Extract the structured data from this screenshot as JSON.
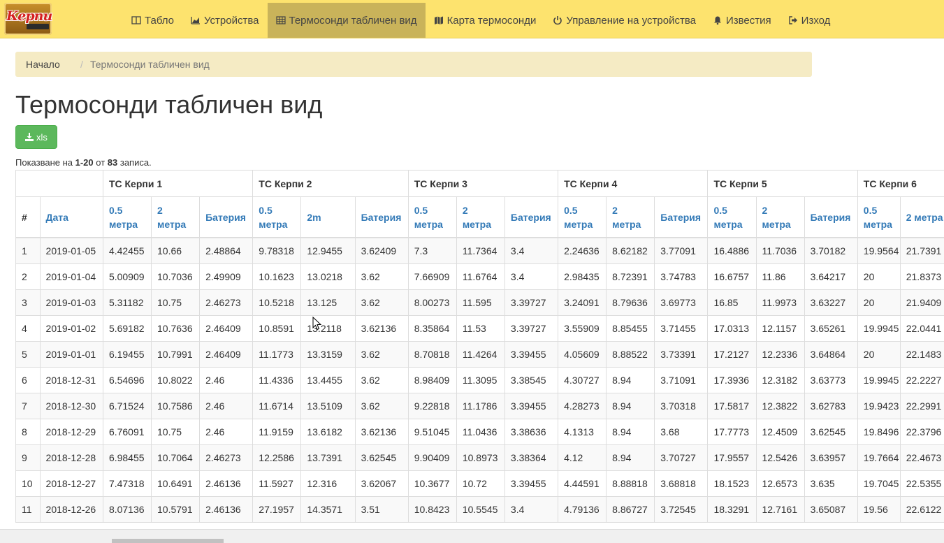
{
  "brand": {
    "text": "Керпи"
  },
  "nav": {
    "items": [
      {
        "label": "Табло",
        "icon": "table-grid-icon"
      },
      {
        "label": "Устройства",
        "icon": "area-chart-icon"
      },
      {
        "label": "Термосонди табличен вид",
        "icon": "table-icon",
        "active": true
      },
      {
        "label": "Карта термосонди",
        "icon": "map-icon"
      },
      {
        "label": "Управление на устройства",
        "icon": "power-icon"
      },
      {
        "label": "Известия",
        "icon": "bell-icon"
      },
      {
        "label": "Изход",
        "icon": "logout-icon"
      }
    ]
  },
  "breadcrumb": {
    "home": "Начало",
    "current": "Термосонди табличен вид"
  },
  "page": {
    "title": "Термосонди табличен вид",
    "xls_label": "xls"
  },
  "summary": {
    "prefix": "Показване на ",
    "range": "1-20",
    "middle": " от ",
    "total": "83",
    "suffix": " записа."
  },
  "table": {
    "groups": [
      "ТС Керпи 1",
      "ТС Керпи 2",
      "ТС Керпи 3",
      "ТС Керпи 4",
      "ТС Керпи 5",
      "ТС Керпи 6"
    ],
    "columns": [
      "#",
      "Дата",
      "0.5 метра",
      "2 метра",
      "Батерия",
      "0.5 метра",
      "2m",
      "Батерия",
      "0.5 метра",
      "2 метра",
      "Батерия",
      "0.5 метра",
      "2 метра",
      "Батерия",
      "0.5 метра",
      "2 метра",
      "Батерия",
      "0.5 метра",
      "2 метра"
    ],
    "rows": [
      [
        "1",
        "2019-01-05",
        "4.42455",
        "10.66",
        "2.48864",
        "9.78318",
        "12.9455",
        "3.62409",
        "7.3",
        "11.7364",
        "3.4",
        "2.24636",
        "8.62182",
        "3.77091",
        "16.4886",
        "11.7036",
        "3.70182",
        "19.9564",
        "21.7391"
      ],
      [
        "2",
        "2019-01-04",
        "5.00909",
        "10.7036",
        "2.49909",
        "10.1623",
        "13.0218",
        "3.62",
        "7.66909",
        "11.6764",
        "3.4",
        "2.98435",
        "8.72391",
        "3.74783",
        "16.6757",
        "11.86",
        "3.64217",
        "20",
        "21.8373"
      ],
      [
        "3",
        "2019-01-03",
        "5.31182",
        "10.75",
        "2.46273",
        "10.5218",
        "13.125",
        "3.62",
        "8.00273",
        "11.595",
        "3.39727",
        "3.24091",
        "8.79636",
        "3.69773",
        "16.85",
        "11.9973",
        "3.63227",
        "20",
        "21.9409"
      ],
      [
        "4",
        "2019-01-02",
        "5.69182",
        "10.7636",
        "2.46409",
        "10.8591",
        "13.2118",
        "3.62136",
        "8.35864",
        "11.53",
        "3.39727",
        "3.55909",
        "8.85455",
        "3.71455",
        "17.0313",
        "12.1157",
        "3.65261",
        "19.9945",
        "22.0441"
      ],
      [
        "5",
        "2019-01-01",
        "6.19455",
        "10.7991",
        "2.46409",
        "11.1773",
        "13.3159",
        "3.62",
        "8.70818",
        "11.4264",
        "3.39455",
        "4.05609",
        "8.88522",
        "3.73391",
        "17.2127",
        "12.2336",
        "3.64864",
        "20",
        "22.1483"
      ],
      [
        "6",
        "2018-12-31",
        "6.54696",
        "10.8022",
        "2.46",
        "11.4336",
        "13.4455",
        "3.62",
        "8.98409",
        "11.3095",
        "3.38545",
        "4.30727",
        "8.94",
        "3.71091",
        "17.3936",
        "12.3182",
        "3.63773",
        "19.9945",
        "22.2227"
      ],
      [
        "7",
        "2018-12-30",
        "6.71524",
        "10.7586",
        "2.46",
        "11.6714",
        "13.5109",
        "3.62",
        "9.22818",
        "11.1786",
        "3.39455",
        "4.28273",
        "8.94",
        "3.70318",
        "17.5817",
        "12.3822",
        "3.62783",
        "19.9423",
        "22.2991"
      ],
      [
        "8",
        "2018-12-29",
        "6.76091",
        "10.75",
        "2.46",
        "11.9159",
        "13.6182",
        "3.62136",
        "9.51045",
        "11.0436",
        "3.38636",
        "4.1313",
        "8.94",
        "3.68",
        "17.7773",
        "12.4509",
        "3.62545",
        "19.8496",
        "22.3796"
      ],
      [
        "9",
        "2018-12-28",
        "6.98455",
        "10.7064",
        "2.46273",
        "12.2586",
        "13.7391",
        "3.62545",
        "9.90409",
        "10.8973",
        "3.38364",
        "4.12",
        "8.94",
        "3.70727",
        "17.9557",
        "12.5426",
        "3.63957",
        "19.7664",
        "22.4673"
      ],
      [
        "10",
        "2018-12-27",
        "7.47318",
        "10.6491",
        "2.46136",
        "11.5927",
        "12.316",
        "3.62067",
        "10.3677",
        "10.72",
        "3.39455",
        "4.44591",
        "8.88818",
        "3.68818",
        "18.1523",
        "12.6573",
        "3.635",
        "19.7045",
        "22.5355"
      ],
      [
        "11",
        "2018-12-26",
        "8.07136",
        "10.5791",
        "2.46136",
        "27.1957",
        "14.3571",
        "3.51",
        "10.8423",
        "10.5545",
        "3.4",
        "4.79136",
        "8.86727",
        "3.72545",
        "18.3291",
        "12.7161",
        "3.65087",
        "19.56",
        "22.6122"
      ]
    ]
  }
}
